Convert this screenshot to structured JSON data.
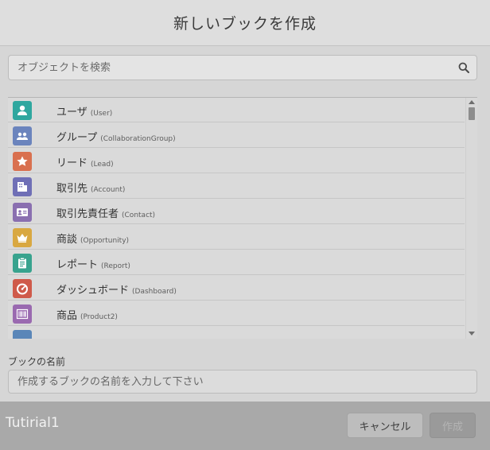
{
  "dialog": {
    "title": "新しいブックを作成"
  },
  "search": {
    "placeholder": "オブジェクトを検索",
    "value": ""
  },
  "objects": [
    {
      "label": "ユーザ",
      "api": "(User)",
      "icon": "user-icon",
      "color": "#2fa79f"
    },
    {
      "label": "グループ",
      "api": "(CollaborationGroup)",
      "icon": "group-icon",
      "color": "#6b84bd"
    },
    {
      "label": "リード",
      "api": "(Lead)",
      "icon": "lead-star-icon",
      "color": "#d9704f"
    },
    {
      "label": "取引先",
      "api": "(Account)",
      "icon": "account-building-icon",
      "color": "#6f6fb6"
    },
    {
      "label": "取引先責任者",
      "api": "(Contact)",
      "icon": "contact-card-icon",
      "color": "#8a6fb0"
    },
    {
      "label": "商談",
      "api": "(Opportunity)",
      "icon": "opportunity-crown-icon",
      "color": "#d9a841"
    },
    {
      "label": "レポート",
      "api": "(Report)",
      "icon": "report-clipboard-icon",
      "color": "#38a38e"
    },
    {
      "label": "ダッシュボード",
      "api": "(Dashboard)",
      "icon": "dashboard-gauge-icon",
      "color": "#cf5a4a"
    },
    {
      "label": "商品",
      "api": "(Product2)",
      "icon": "product-barcode-icon",
      "color": "#9a6ab0"
    },
    {
      "label": "",
      "api": "",
      "icon": "partial-icon",
      "color": "#5a86b8"
    }
  ],
  "book_name": {
    "label": "ブックの名前",
    "placeholder": "作成するブックの名前を入力して下さい",
    "value": ""
  },
  "footer": {
    "tutorial_label": "Tutirial1",
    "cancel_label": "キャンセル",
    "create_label": "作成"
  }
}
